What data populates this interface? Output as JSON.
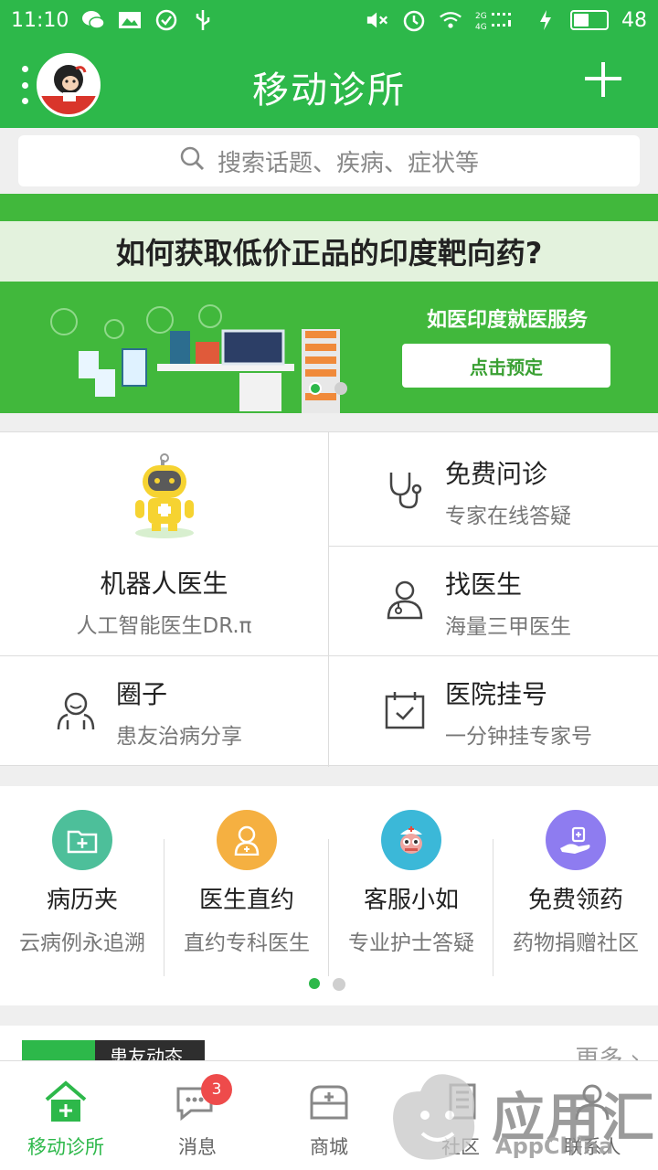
{
  "status_bar": {
    "time": "11:10",
    "battery": "48",
    "battery_level": 0.48
  },
  "header": {
    "title": "移动诊所"
  },
  "search": {
    "placeholder": "搜索话题、疾病、症状等"
  },
  "banner": {
    "headline": "如何获取低价正品的印度靶向药?",
    "service": "如医印度就医服务",
    "button": "点击预定"
  },
  "services": {
    "robot": {
      "title": "机器人医生",
      "subtitle": "人工智能医生DR.π"
    },
    "free_consult": {
      "title": "免费问诊",
      "subtitle": "专家在线答疑"
    },
    "find_doctor": {
      "title": "找医生",
      "subtitle": "海量三甲医生"
    },
    "circle": {
      "title": "圈子",
      "subtitle": "患友治病分享"
    },
    "hospital": {
      "title": "医院挂号",
      "subtitle": "一分钟挂专家号"
    }
  },
  "quick": [
    {
      "title": "病历夹",
      "subtitle": "云病例永追溯",
      "color": "#4dbf9a"
    },
    {
      "title": "医生直约",
      "subtitle": "直约专科医生",
      "color": "#f5b041"
    },
    {
      "title": "客服小如",
      "subtitle": "专业护士答疑",
      "color": "#3bb8d8"
    },
    {
      "title": "免费领药",
      "subtitle": "药物捐赠社区",
      "color": "#8e7cf0"
    }
  ],
  "news": {
    "label": "患友动态",
    "more": "更多"
  },
  "tabs": [
    {
      "label": "移动诊所"
    },
    {
      "label": "消息",
      "badge": "3"
    },
    {
      "label": "商城"
    },
    {
      "label": "社区"
    },
    {
      "label": "联系人"
    }
  ],
  "watermark": {
    "text": "应用汇",
    "sub": "AppChina"
  },
  "colors": {
    "brand": "#2db84a",
    "badge": "#ee4b4b"
  }
}
